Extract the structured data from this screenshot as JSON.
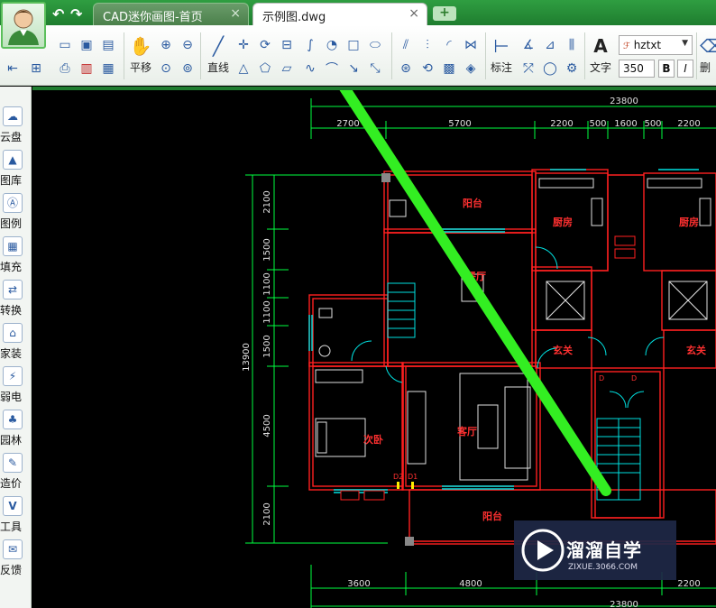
{
  "titlebar": {
    "tabs": [
      {
        "label": "CAD迷你画图-首页",
        "active": false
      },
      {
        "label": "示例图.dwg",
        "active": true
      }
    ]
  },
  "toolbar": {
    "pan_label": "平移",
    "line_label": "直线",
    "annotate_label": "标注",
    "text_label": "文字",
    "font_name": "hztxt",
    "font_size": "350",
    "bold_label": "B",
    "italic_label": "I",
    "delete_label": "删"
  },
  "sidebar": {
    "items": [
      {
        "label": "云盘"
      },
      {
        "label": "图库"
      },
      {
        "label": "图例"
      },
      {
        "label": "填充"
      },
      {
        "label": "转换"
      },
      {
        "label": "家装"
      },
      {
        "label": "弱电"
      },
      {
        "label": "园林"
      },
      {
        "label": "造价"
      },
      {
        "label": "工具"
      },
      {
        "label": "反馈"
      }
    ]
  },
  "drawing": {
    "dims_top_total": "23800",
    "dims_top": [
      "2700",
      "5700",
      "2200",
      "500",
      "1600",
      "500",
      "2200"
    ],
    "dims_left_total": "13900",
    "dims_left": [
      "2100",
      "1500",
      "1100",
      "1100",
      "1500",
      "4500",
      "2100"
    ],
    "dims_bottom": [
      "3600",
      "4800",
      "2200"
    ],
    "dims_bottom_total": "23800",
    "rooms": [
      "阳台",
      "厨房",
      "厨房",
      "餐厅",
      "玄关",
      "玄关",
      "次卧",
      "客厅",
      "阳台"
    ],
    "door_tags": [
      "D2",
      "D1",
      "D",
      "D"
    ]
  },
  "watermark": {
    "title": "溜溜自学",
    "url": "ZIXUE.3066.COM"
  },
  "colors": {
    "accent": "#1f7d2f",
    "wall": "#ff2020",
    "dim": "#00e0e0",
    "dim_line": "#00ff40",
    "room_text": "#ff3030",
    "arrow": "#33ee22"
  }
}
